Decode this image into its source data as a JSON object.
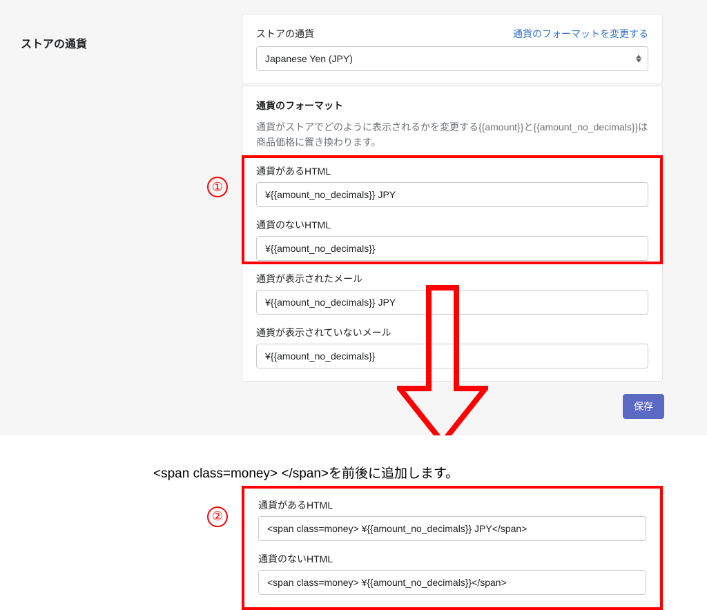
{
  "left": {
    "title": "ストアの通貨"
  },
  "card1": {
    "label": "ストアの通貨",
    "link": "通貨のフォーマットを変更する",
    "selected": "Japanese Yen (JPY)"
  },
  "card2": {
    "title": "通貨のフォーマット",
    "desc": "通貨がストアでどのように表示されるかを変更する{{amount}}と{{amount_no_decimals}}は商品価格に置き換わります。",
    "f1": {
      "label": "通貨があるHTML",
      "value": "¥{{amount_no_decimals}} JPY"
    },
    "f2": {
      "label": "通貨のないHTML",
      "value": "¥{{amount_no_decimals}}"
    },
    "f3": {
      "label": "通貨が表示されたメール",
      "value": "¥{{amount_no_decimals}} JPY"
    },
    "f4": {
      "label": "通貨が表示されていないメール",
      "value": "¥{{amount_no_decimals}}"
    }
  },
  "footer": {
    "save": "保存"
  },
  "annot": {
    "badge1": "①",
    "badge2": "②",
    "instruction": "<span class=money> </span>を前後に追加します。"
  },
  "bottom": {
    "f1": {
      "label": "通貨があるHTML",
      "value": "<span class=money> ¥{{amount_no_decimals}} JPY</span>"
    },
    "f2": {
      "label": "通貨のないHTML",
      "value": "<span class=money> ¥{{amount_no_decimals}}</span>"
    }
  }
}
